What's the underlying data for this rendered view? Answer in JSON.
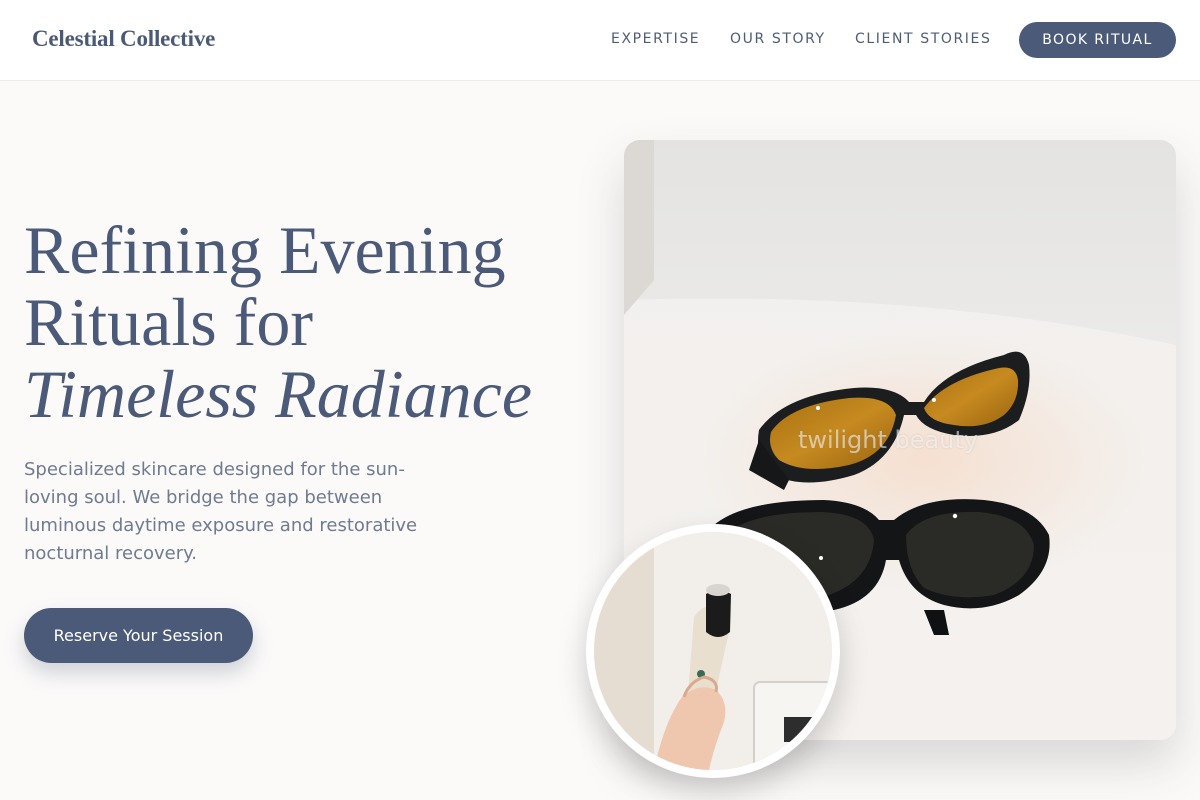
{
  "header": {
    "brand": "Celestial Collective",
    "nav": [
      {
        "label": "EXPERTISE"
      },
      {
        "label": "OUR STORY"
      },
      {
        "label": "CLIENT STORIES"
      }
    ],
    "cta_label": "BOOK RITUAL"
  },
  "hero": {
    "title_line1": "Refining Evening",
    "title_line2": "Rituals for",
    "title_line3_italic": "Timeless Radiance",
    "description": "Specialized skincare designed for the sun-loving soul. We bridge the gap between luminous daytime exposure and restorative nocturnal recovery.",
    "cta_label": "Reserve Your Session"
  },
  "media": {
    "main_photo_watermark": "twilight beauty"
  },
  "colors": {
    "accent": "#4a5a78",
    "background": "#fcfaf9",
    "body_text": "#6e7b90"
  }
}
